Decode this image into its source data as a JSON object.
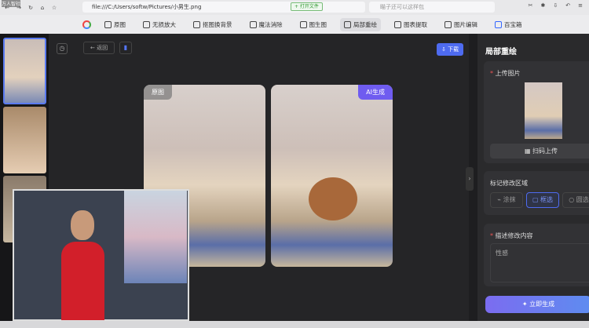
{
  "watermark": "万人智社",
  "browser": {
    "url": "file:///C:/Users/softw/Pictures/小男生.png",
    "open_file": "+ 打开文件",
    "search_placeholder": "瞄子还可以这样包"
  },
  "toolbar": {
    "items": [
      "原图",
      "无损放大",
      "抠图换背景",
      "魔法消除",
      "图生图",
      "局部重绘",
      "图表提取",
      "图片编辑",
      "百宝箱"
    ],
    "active": "局部重绘"
  },
  "main": {
    "back": "← 返回",
    "download": "⇩ 下载",
    "original_tag": "原图",
    "ai_tag": "AI生成"
  },
  "side": {
    "title": "局部重绘",
    "upload_label": "上传图片",
    "scan_upload": "扫码上传",
    "mark_label": "标记修改区域",
    "mark_options": [
      "涂抹",
      "框选",
      "圆选"
    ],
    "mark_selected": "框选",
    "describe_label": "描述修改内容",
    "describe_value": "性感",
    "generate": "立即生成"
  },
  "colors": {
    "accent": "#4e6bf0",
    "ai_tag": "#6f5cf0"
  }
}
